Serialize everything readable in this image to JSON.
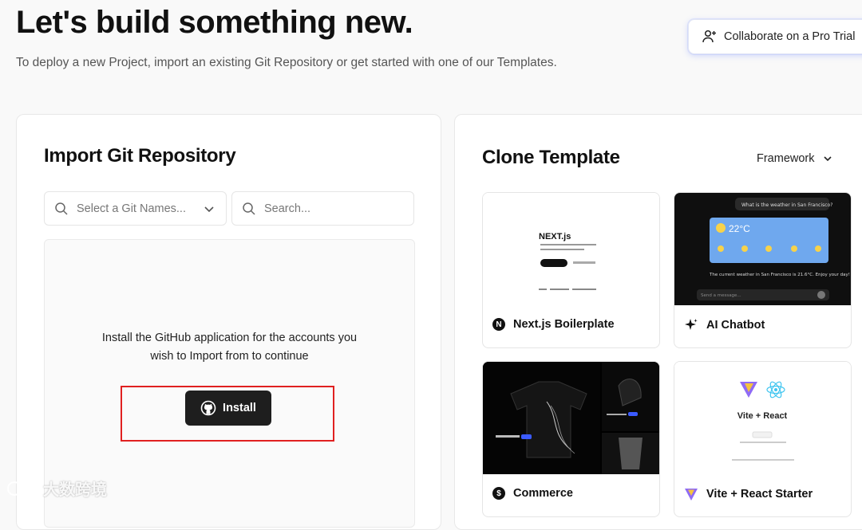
{
  "header": {
    "title": "Let's build something new.",
    "subtitle": "To deploy a new Project, import an existing Git Repository or get started with one of our Templates.",
    "pro_button": "Collaborate on a Pro Trial"
  },
  "import": {
    "title": "Import Git Repository",
    "namespace_placeholder": "Select a Git Names...",
    "search_placeholder": "Search...",
    "install_message_line1": "Install the GitHub application for the accounts you",
    "install_message_line2": "wish to Import from to continue",
    "install_button": "Install"
  },
  "clone": {
    "title": "Clone Template",
    "framework_label": "Framework",
    "templates": [
      {
        "name": "Next.js Boilerplate",
        "icon": "nextjs-icon"
      },
      {
        "name": "AI Chatbot",
        "icon": "sparkle-icon"
      },
      {
        "name": "Commerce",
        "icon": "dollar-icon"
      },
      {
        "name": "Vite + React Starter",
        "icon": "vite-icon"
      }
    ],
    "previews": {
      "nextjs_logo": "NEXT.js",
      "chatbot_question": "What is the weather in San Francisco?",
      "chatbot_temp": "22°C",
      "chatbot_answer": "The current weather in San Francisco is 21.6°C. Enjoy your day!",
      "chatbot_input_placeholder": "Send a message...",
      "vite_title": "Vite + React"
    }
  },
  "watermark": "大数跨境"
}
